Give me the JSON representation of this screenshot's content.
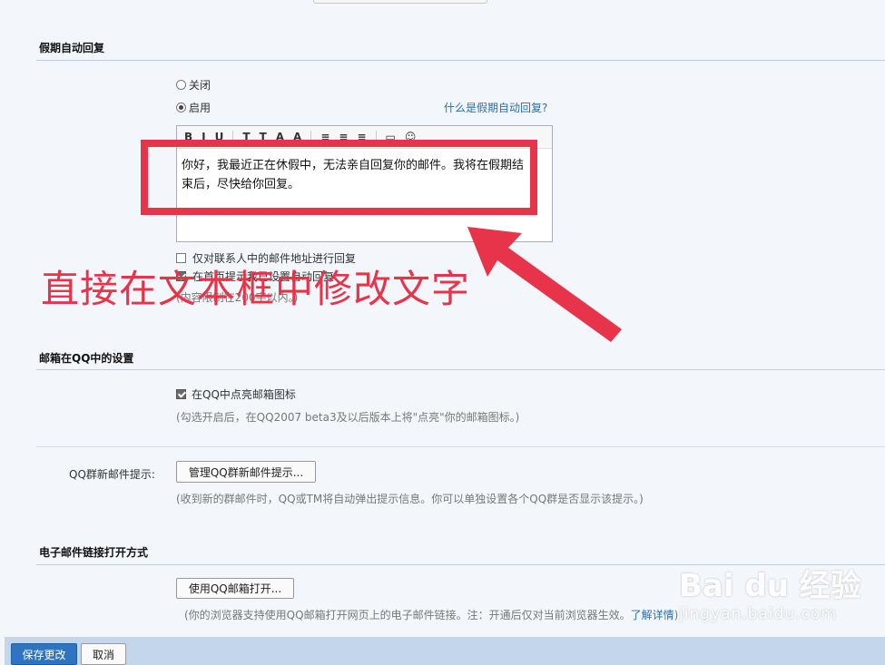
{
  "vacation": {
    "title": "假期自动回复",
    "options": {
      "off": "关闭",
      "on": "启用"
    },
    "help_link": "什么是假期自动回复?",
    "toolbar": [
      "B",
      "I",
      "U",
      "T",
      "T",
      "A",
      "A",
      "≡",
      "≡",
      "≡",
      "▭",
      "☺"
    ],
    "message": "你好，我最近正在休假中，无法亲自回复你的邮件。我将在假期结\n束后，尽快给你回复。",
    "contacts_only": "仅对联系人中的邮件地址进行回复",
    "show_on_home": "在首页提示我已设置自动回复",
    "limit_hint": "(内容限制在200字以内。)"
  },
  "annotation": {
    "text": "直接在文本框中修改文字",
    "color": "#e8344a"
  },
  "qq_settings": {
    "title": "邮箱在QQ中的设置",
    "highlight_icon": "在QQ中点亮邮箱图标",
    "highlight_hint": "(勾选开启后，在QQ2007 beta3及以后版本上将\"点亮\"你的邮箱图标。)",
    "group_label": "QQ群新邮件提示:",
    "group_button": "管理QQ群新邮件提示...",
    "group_hint": "(收到新的群邮件时，QQ或TM将自动弹出提示信息。你可以单独设置各个QQ群是否显示该提示。)"
  },
  "email_link": {
    "title": "电子邮件链接打开方式",
    "button": "使用QQ邮箱打开...",
    "hint": "(你的浏览器支持使用QQ邮箱打开网页上的电子邮件链接。注：开通后仅对当前浏览器生效。",
    "learn_more": "了解详情",
    "hint_end": ")"
  },
  "footer": {
    "save": "保存更改",
    "cancel": "取消"
  },
  "watermark": {
    "logo": "Bai du 经验",
    "url": "jingyan.baidu.com"
  },
  "colors": {
    "accent": "#2f74c0",
    "annotation": "#e8344a",
    "divider": "#b8cfe6"
  }
}
